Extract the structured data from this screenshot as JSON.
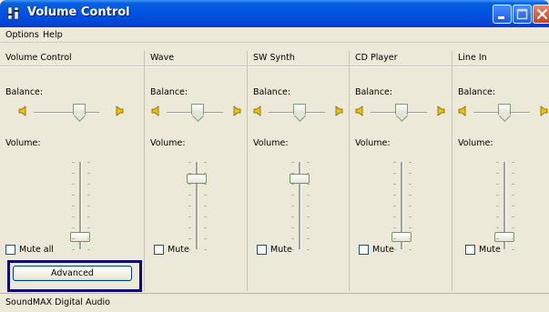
{
  "window": {
    "title": "Volume Control"
  },
  "menu": [
    "Options",
    "Help"
  ],
  "channels": [
    {
      "name": "Volume Control",
      "balance_label": "Balance:",
      "volume_label": "Volume:",
      "mute_label": "Mute all",
      "volume_level": 0.1,
      "balance": 0.5
    },
    {
      "name": "Wave",
      "balance_label": "Balance:",
      "volume_label": "Volume:",
      "mute_label": "Mute",
      "volume_level": 0.85,
      "balance": 0.5
    },
    {
      "name": "SW Synth",
      "balance_label": "Balance:",
      "volume_label": "Volume:",
      "mute_label": "Mute",
      "volume_level": 0.85,
      "balance": 0.5
    },
    {
      "name": "CD Player",
      "balance_label": "Balance:",
      "volume_label": "Volume:",
      "mute_label": "Mute",
      "volume_level": 0.1,
      "balance": 0.5
    },
    {
      "name": "Line In",
      "balance_label": "Balance:",
      "volume_label": "Volume:",
      "mute_label": "Mute",
      "volume_level": 0.1,
      "balance": 0.5
    }
  ],
  "advanced_button": "Advanced",
  "status": "SoundMAX Digital Audio",
  "colors": {
    "titlebar": "#0055e5",
    "highlight_box": "#0b0b78",
    "window_bg": "#ece9d8"
  }
}
